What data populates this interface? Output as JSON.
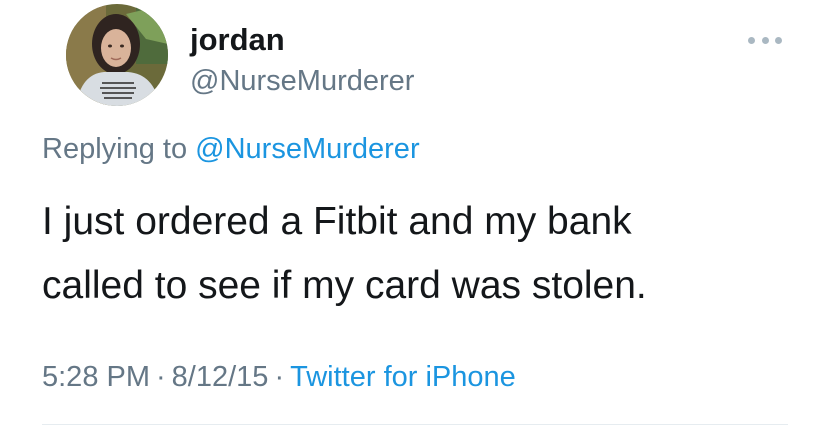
{
  "author": {
    "display_name": "jordan",
    "handle": "@NurseMurderer",
    "avatar_icon": "profile-photo"
  },
  "menu": {
    "icon": "more-horizontal-icon"
  },
  "reply": {
    "prefix": "Replying to",
    "mention": "@NurseMurderer"
  },
  "tweet": {
    "lines": [
      "I just ordered a Fitbit and my bank",
      "called to see if my card was stolen."
    ]
  },
  "meta": {
    "time": "5:28 PM",
    "separator": "·",
    "date": "8/12/15",
    "source": "Twitter for iPhone"
  },
  "colors": {
    "text": "#14171a",
    "secondary": "#657786",
    "link": "#1b95e0",
    "divider": "#e6ecf0"
  }
}
